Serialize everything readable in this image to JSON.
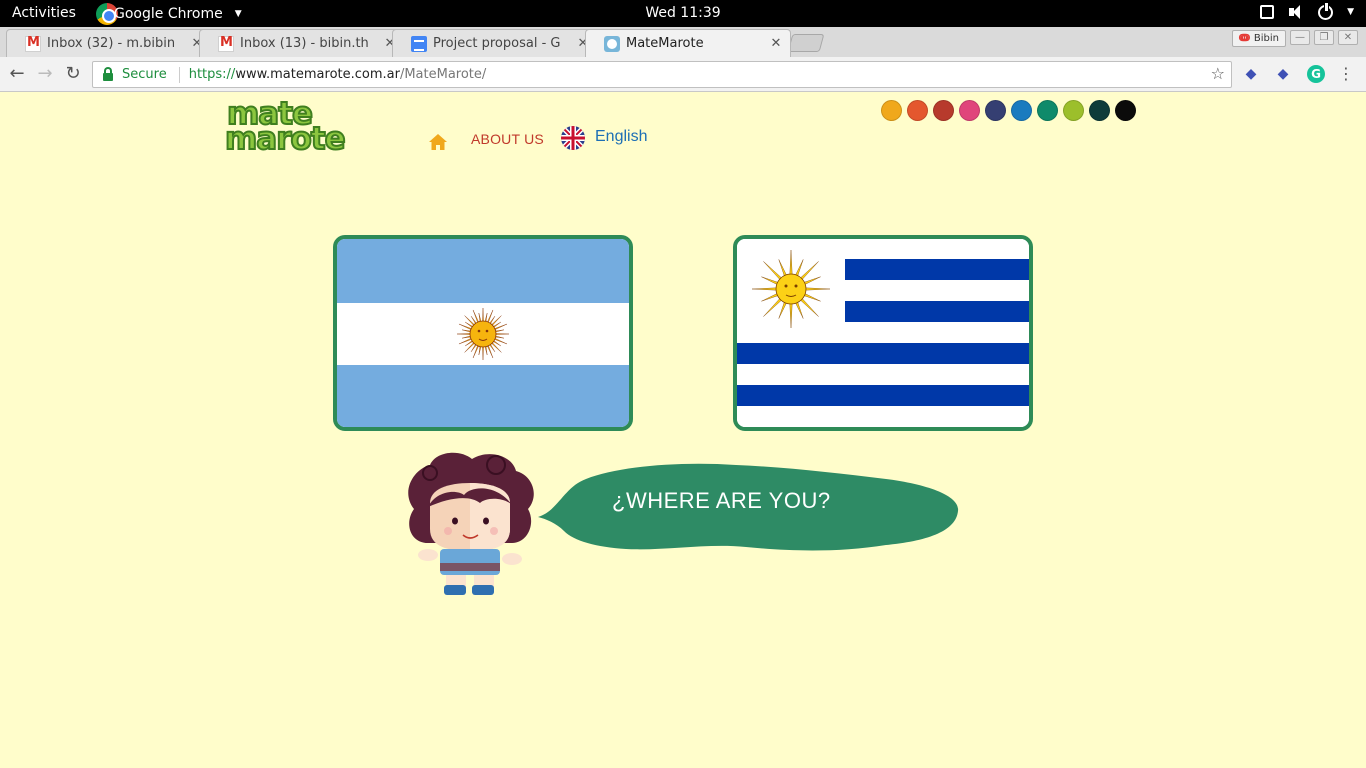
{
  "system_bar": {
    "activities": "Activities",
    "app_name": "Google Chrome",
    "clock": "Wed 11:39"
  },
  "browser": {
    "tabs": [
      {
        "title": "Inbox (32) - m.bibin",
        "icon": "gmail-icon",
        "active": false
      },
      {
        "title": "Inbox (13) - bibin.th",
        "icon": "gmail-icon",
        "active": false
      },
      {
        "title": "Project proposal - G",
        "icon": "google-docs-icon",
        "active": false
      },
      {
        "title": "MateMarote",
        "icon": "matemarote-favicon",
        "active": true
      }
    ],
    "profile_name": "Bibin",
    "address": {
      "secure_label": "Secure",
      "scheme": "https://",
      "host": "www.matemarote.com.ar",
      "path": "/MateMarote/"
    }
  },
  "site": {
    "logo_line1": "mate",
    "logo_line2": "marote",
    "nav": {
      "about": "ABOUT US",
      "language": "English"
    },
    "theme_colors": [
      "#f0a81c",
      "#e4572e",
      "#b73a2c",
      "#e0457b",
      "#353f72",
      "#1a7bbf",
      "#0f8a6a",
      "#9cbf2b",
      "#0e3b3a",
      "#0b0b0b"
    ],
    "flags": [
      {
        "country": "Argentina",
        "stripe_colors": [
          "#74acdf",
          "#ffffff",
          "#74acdf"
        ]
      },
      {
        "country": "Uruguay",
        "stripe_colors": [
          "#0038a8",
          "#ffffff"
        ]
      }
    ],
    "speech_bubble": "¿WHERE ARE YOU?",
    "bubble_color": "#2e8b65"
  }
}
